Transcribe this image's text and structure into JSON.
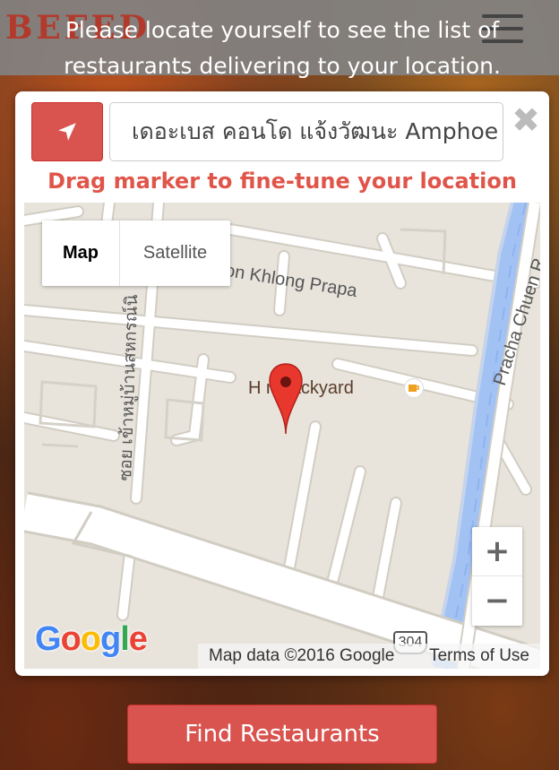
{
  "header": {
    "brand": "BEFED",
    "prompt": "Please locate yourself to see the list of restaurants delivering to your location."
  },
  "modal": {
    "address_value": "เดอะเบส คอนโด แจ้งวัฒนะ Amphoe",
    "close_glyph": "✖",
    "hint": "Drag marker to fine-tune your location"
  },
  "map": {
    "type_map": "Map",
    "type_satellite": "Satellite",
    "labels": {
      "khlong_prapa": "on Khlong Prapa",
      "pracha_chuen": "Pracha Chuen R",
      "soi": "ซอย เข้าหมู่บ้านสหกรณ์นิ",
      "poi": "H    n backyard"
    },
    "zoom_in": "+",
    "zoom_out": "−",
    "logo": "Google",
    "route_shield": "304",
    "attribution_data": "Map data ©2016 Google",
    "attribution_terms": "Terms of Use",
    "colors": {
      "land": "#e8e4dc",
      "road": "#ffffff",
      "canal": "#a3c2f4",
      "marker": "#e8372c"
    }
  },
  "footer": {
    "find_button": "Find Restaurants"
  },
  "colors": {
    "accent": "#d9534f",
    "hint_text": "#e0554a"
  }
}
